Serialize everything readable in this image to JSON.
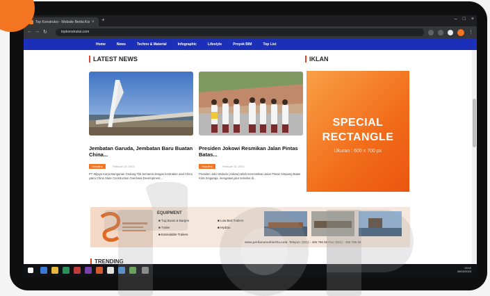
{
  "browser": {
    "tab_title": "Top Konstruksi - Website Berita Kon...",
    "tab_close": "×",
    "new_tab": "+",
    "url": "topkonstruksi.com",
    "window_controls": [
      "–",
      "□",
      "×"
    ]
  },
  "site_nav": {
    "items": [
      "Home",
      "News",
      "Techno & Material",
      "Infographic",
      "Lifestyle",
      "Proyek BIM",
      "Top List"
    ]
  },
  "main": {
    "latest_news_heading": "LATEST NEWS",
    "ad_heading": "IKLAN",
    "articles": [
      {
        "headline": "Jembatan Garuda, Jembatan Baru Buatan China...",
        "category": "Headline",
        "date": "Februari 10, 2023",
        "excerpt": "PT Wijaya Karya Bangunan Gedung Tbk bersama dengan kontraktor asal China yakni China State Construction Overseas Development..."
      },
      {
        "headline": "Presiden Jokowi Resmikan Jalan Pintas Batas...",
        "category": "Headline",
        "date": "Februari 10, 2023",
        "excerpt": "Presiden Joko Widodo (Jokowi) telah meresmikan Jalan Pintas Simpang Batas Kota Singaraja, mengatasi jalur tersebut di..."
      }
    ]
  },
  "ad": {
    "line1": "SPECIAL",
    "line2": "RECTANGLE",
    "size": "Ukuran : 600 x 700 px"
  },
  "banner": {
    "heading": "EQUIPMENT",
    "items": [
      "Tug Boats & Barges",
      "Trailer",
      "Extendable Trailers",
      "Low Bed Trailers",
      "Hydrau"
    ],
    "url": "www.perdanamultiartha.com",
    "contact": "Telepon: (021) - 455 766 55 Fax: (021) - 455 766 66"
  },
  "trending_heading": "TRENDING",
  "taskbar": {
    "time": "13:02",
    "date": "05/02/2023"
  },
  "colors": {
    "nav_blue": "#1b2fb8",
    "accent_orange": "#f37521",
    "section_marker": "#e0442f"
  }
}
